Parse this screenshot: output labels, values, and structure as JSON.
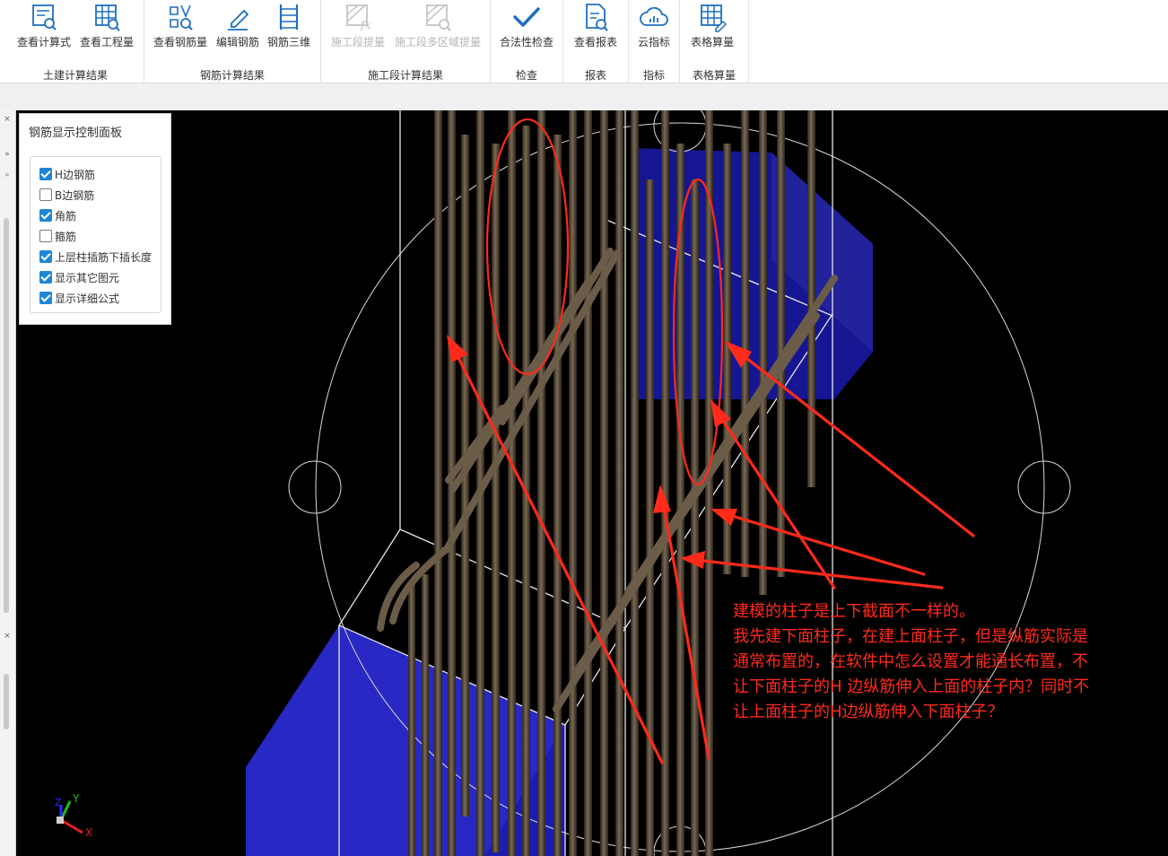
{
  "ribbon": {
    "groups": [
      {
        "label": "土建计算结果",
        "buttons": [
          {
            "label": "查看计算式",
            "icon": "view-formula-icon",
            "disabled": false
          },
          {
            "label": "查看工程量",
            "icon": "view-quantity-icon",
            "disabled": false
          }
        ]
      },
      {
        "label": "钢筋计算结果",
        "buttons": [
          {
            "label": "查看钢筋量",
            "icon": "view-rebar-quantity-icon",
            "disabled": false
          },
          {
            "label": "编辑钢筋",
            "icon": "edit-rebar-icon",
            "disabled": false
          },
          {
            "label": "钢筋三维",
            "icon": "rebar-3d-icon",
            "disabled": false
          }
        ]
      },
      {
        "label": "施工段计算结果",
        "buttons": [
          {
            "label": "施工段提量",
            "icon": "segment-quantity-icon",
            "disabled": true
          },
          {
            "label": "施工段多区域提量",
            "icon": "segment-multi-area-icon",
            "disabled": true
          }
        ]
      },
      {
        "label": "检查",
        "buttons": [
          {
            "label": "合法性检查",
            "icon": "check-mark-icon",
            "disabled": false
          }
        ]
      },
      {
        "label": "报表",
        "buttons": [
          {
            "label": "查看报表",
            "icon": "view-report-icon",
            "disabled": false
          }
        ]
      },
      {
        "label": "指标",
        "buttons": [
          {
            "label": "云指标",
            "icon": "cloud-index-icon",
            "disabled": false
          }
        ]
      },
      {
        "label": "表格算量",
        "buttons": [
          {
            "label": "表格算量",
            "icon": "table-calc-icon",
            "disabled": false
          }
        ]
      }
    ]
  },
  "panel": {
    "title": "钢筋显示控制面板",
    "options": [
      {
        "label": "H边钢筋",
        "checked": true
      },
      {
        "label": "B边钢筋",
        "checked": false
      },
      {
        "label": "角筋",
        "checked": true
      },
      {
        "label": "箍筋",
        "checked": false
      },
      {
        "label": "上层柱插筋下插长度",
        "checked": true
      },
      {
        "label": "显示其它图元",
        "checked": true
      },
      {
        "label": "显示详细公式",
        "checked": true
      }
    ]
  },
  "annotation": {
    "lines": [
      "建模的柱子是上下截面不一样的。",
      "我先建下面柱子，在建上面柱子，但是纵筋实际是",
      "通常布置的，在软件中怎么设置才能通长布置，不",
      "让下面柱子的H 边纵筋伸入上面的柱子内？同时不",
      "让上面柱子的H边纵筋伸入下面柱子？"
    ]
  },
  "axis": {
    "x": "X",
    "y": "Y",
    "z": "Z"
  },
  "colors": {
    "accent": "#1e86d6",
    "annotation": "#ff2a1a",
    "rebar": "#5a4e3e",
    "member": "#1a1aa8",
    "viewport": "#000000"
  }
}
